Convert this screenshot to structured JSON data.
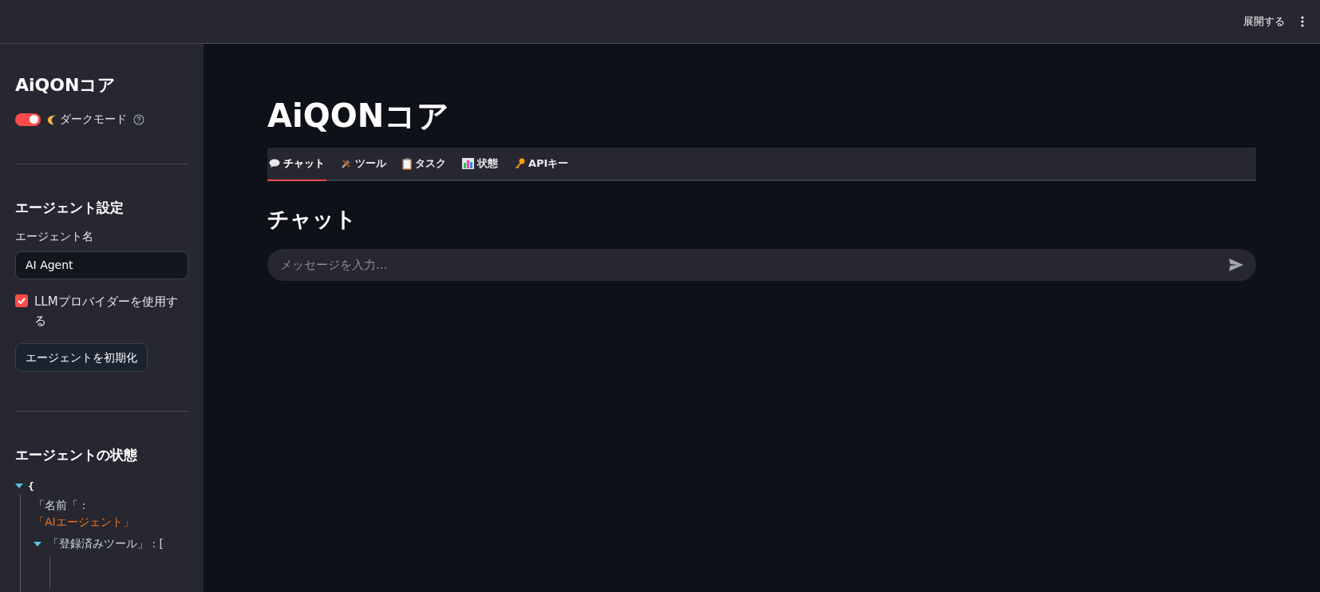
{
  "header": {
    "expand_button": "展開する"
  },
  "sidebar": {
    "title": "AiQONコア",
    "dark_mode": {
      "label": "ダークモード",
      "on": true
    },
    "agent_settings": {
      "heading": "エージェント設定",
      "name_label": "エージェント名",
      "name_value": "AI Agent",
      "use_llm": {
        "label": "LLMプロバイダーを使用する",
        "checked": true
      },
      "init_button": "エージェントを初期化"
    },
    "agent_state": {
      "heading": "エージェントの状態",
      "tree": {
        "label": "{",
        "expanded": true,
        "children": [
          {
            "kind": "pair",
            "key": "「名前「 :",
            "value": "「AIエージェント」"
          },
          {
            "kind": "node",
            "label": "「登録済みツール」 : [",
            "expanded": true
          }
        ]
      }
    }
  },
  "main": {
    "title": "AiQONコア",
    "tabs": [
      {
        "kind": "chat",
        "label": "チャット",
        "selected": true
      },
      {
        "kind": "tools",
        "label": "ツール",
        "selected": false
      },
      {
        "kind": "clipboard",
        "label": "タスク",
        "selected": false
      },
      {
        "kind": "chart",
        "label": "状態",
        "selected": false
      },
      {
        "kind": "key",
        "label": "APIキー",
        "selected": false
      }
    ],
    "section_heading": "チャット",
    "chat_input": {
      "placeholder": "メッセージを入力..."
    }
  }
}
